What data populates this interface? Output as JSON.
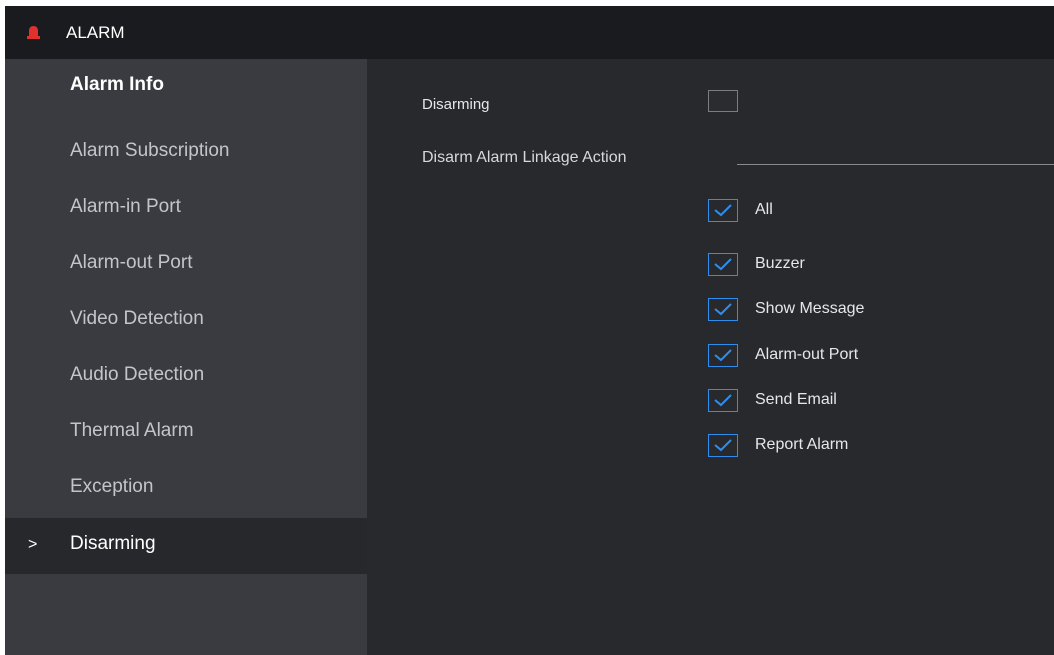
{
  "header": {
    "title": "ALARM",
    "logo_icon": "alarm-siren-icon",
    "logo_color": "#e0312f"
  },
  "sidebar": {
    "items": [
      {
        "label": "Alarm Info"
      },
      {
        "label": "Alarm Subscription"
      },
      {
        "label": "Alarm-in Port"
      },
      {
        "label": "Alarm-out Port"
      },
      {
        "label": "Video Detection"
      },
      {
        "label": "Audio Detection"
      },
      {
        "label": "Thermal Alarm"
      },
      {
        "label": "Exception"
      },
      {
        "label": "Disarming",
        "chevron": ">"
      }
    ],
    "active_item": "Disarming"
  },
  "main": {
    "disarming_label": "Disarming",
    "disarming_checked": false,
    "linkage_section_title": "Disarm Alarm Linkage Action",
    "options": [
      {
        "label": "All",
        "checked": true
      },
      {
        "label": "Buzzer",
        "checked": true
      },
      {
        "label": "Show Message",
        "checked": true
      },
      {
        "label": "Alarm-out Port",
        "checked": true
      },
      {
        "label": "Send Email",
        "checked": true
      },
      {
        "label": "Report Alarm",
        "checked": true
      }
    ]
  },
  "colors": {
    "accent": "#2d8ef0",
    "panel": "#28292d",
    "sidebar": "#3a3b40",
    "header": "#1a1b1e"
  }
}
